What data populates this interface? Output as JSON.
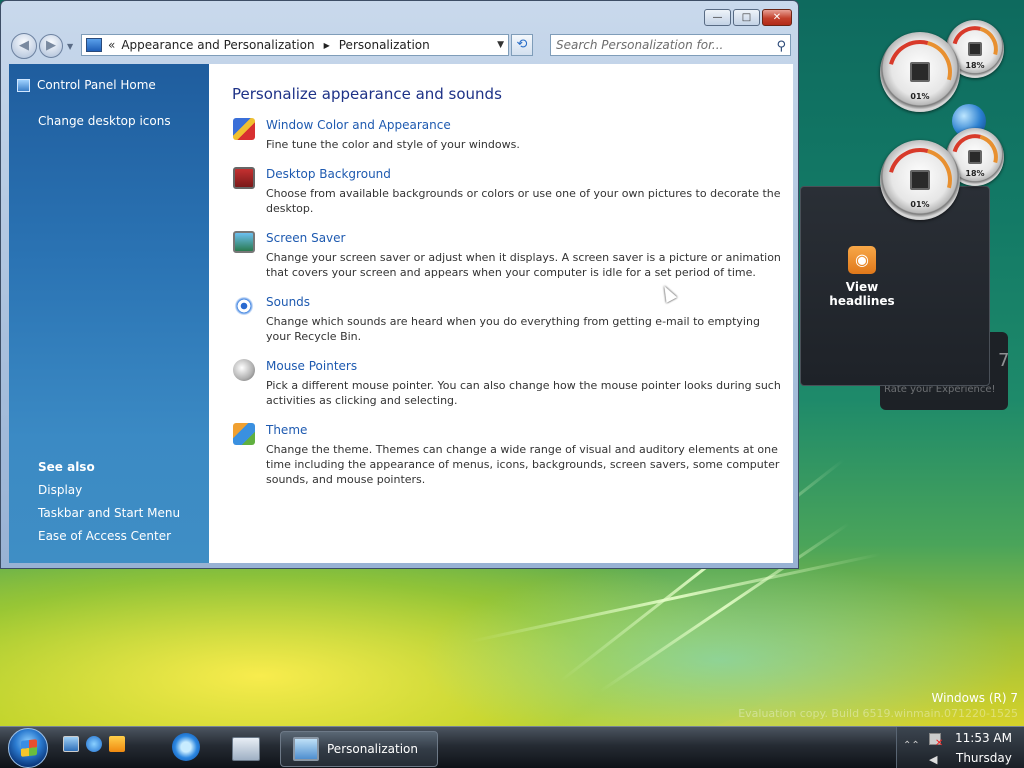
{
  "window": {
    "buttons": {
      "minimize": "—",
      "maximize": "□",
      "close": "✕"
    },
    "address": {
      "chevron": "«",
      "crumbs": [
        "Appearance and Personalization",
        "Personalization"
      ],
      "separator": "▶",
      "dropdown": "▼"
    },
    "search": {
      "placeholder": "Search Personalization for..."
    },
    "icons": {
      "back": "back-arrow-icon",
      "forward": "forward-arrow-icon",
      "refresh": "refresh-icon",
      "search": "magnifier-icon"
    }
  },
  "sidebar": {
    "home": "Control Panel Home",
    "tasks": [
      "Change desktop icons"
    ],
    "see_also_heading": "See also",
    "see_also": [
      "Display",
      "Taskbar and Start Menu",
      "Ease of Access Center"
    ]
  },
  "content": {
    "heading": "Personalize appearance and sounds",
    "items": [
      {
        "title": "Window Color and Appearance",
        "desc": "Fine tune the color and style of your windows.",
        "icon": "window-color-icon"
      },
      {
        "title": "Desktop Background",
        "desc": "Choose from available backgrounds or colors or use one of your own pictures to decorate the desktop.",
        "icon": "desktop-background-icon"
      },
      {
        "title": "Screen Saver",
        "desc": "Change your screen saver or adjust when it displays. A screen saver is a picture or animation that covers your screen and appears when your computer is idle for a set period of time.",
        "icon": "screen-saver-icon"
      },
      {
        "title": "Sounds",
        "desc": "Change which sounds are heard when you do everything from getting e-mail to emptying your Recycle Bin.",
        "icon": "sounds-icon"
      },
      {
        "title": "Mouse Pointers",
        "desc": "Pick a different mouse pointer. You can also change how the mouse pointer looks during such activities as clicking and selecting.",
        "icon": "mouse-pointers-icon"
      },
      {
        "title": "Theme",
        "desc": "Change the theme. Themes can change a wide range of visual and auditory elements at one time including the appearance of menus, icons, backgrounds, screen savers, some computer sounds, and mouse pointers.",
        "icon": "theme-icon"
      }
    ]
  },
  "gadgets": {
    "cpu_meters": [
      {
        "cpu": "01%",
        "ram": "18%"
      },
      {
        "cpu": "01%",
        "ram": "18%"
      }
    ],
    "feed_button": "View headlines",
    "rate_label": "Rate your Experience!",
    "fragment": "7"
  },
  "desktop": {
    "watermark_title": "Windows (R) 7",
    "watermark_build": "Evaluation copy. Build 6519.winmain.071220-1525"
  },
  "taskbar": {
    "active_task": "Personalization",
    "clock_time": "11:53 AM",
    "clock_day": "Thursday",
    "tray_expand": "⌃⌃",
    "volume_icon": "◀"
  },
  "colors": {
    "link_blue": "#1e5ab0",
    "heading_blue": "#1e3287",
    "left_pane_blue": "#2b74b4"
  }
}
